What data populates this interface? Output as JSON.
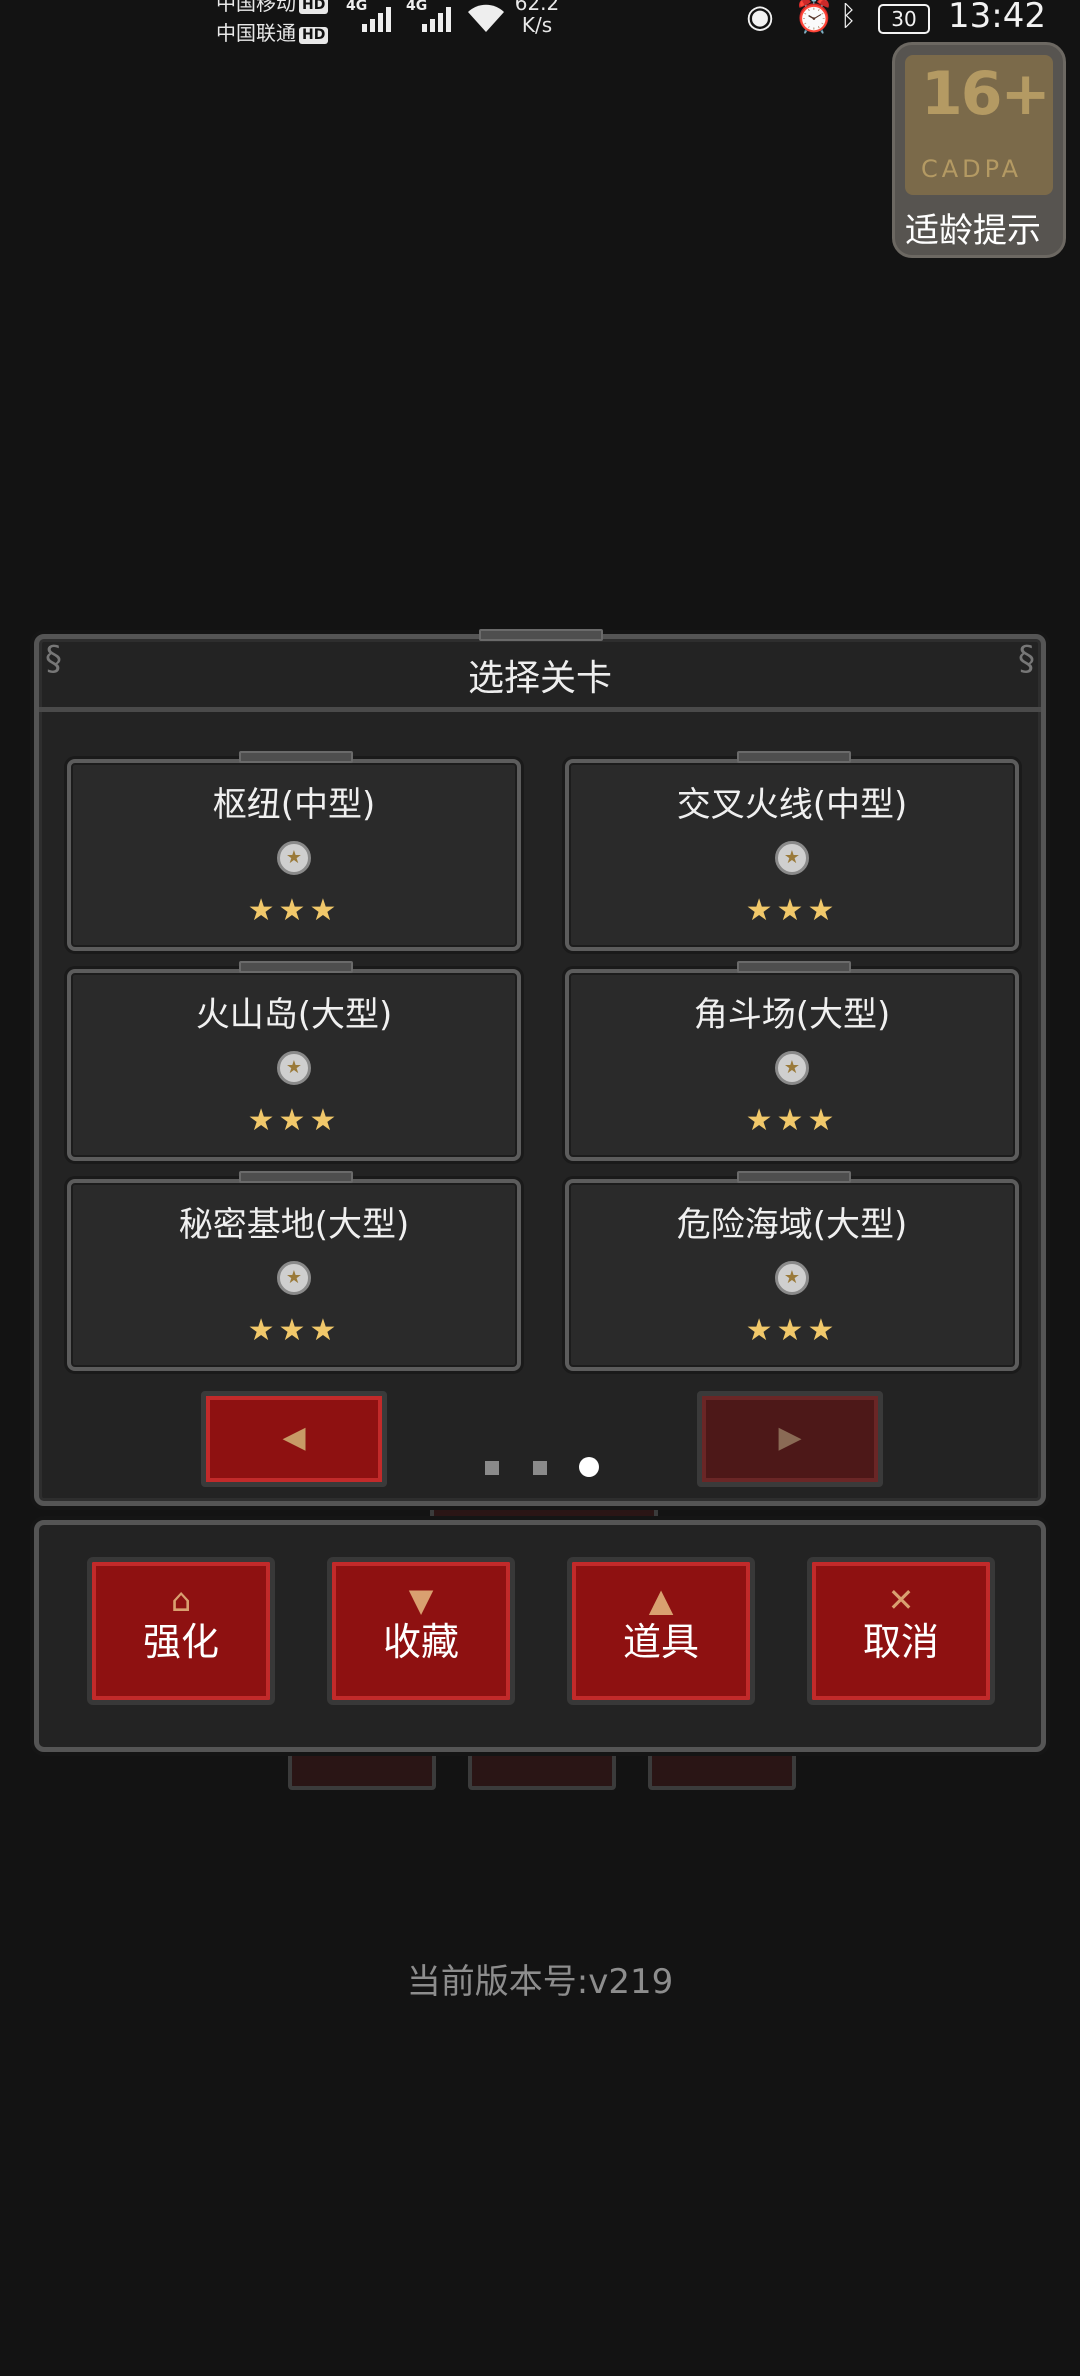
{
  "status_bar": {
    "carrier1": "中国移动",
    "carrier2": "中国联通",
    "hd_badge": "HD",
    "network_type": "4G",
    "net_speed_value": "62.2",
    "net_speed_unit": "K/s",
    "battery_level": "30",
    "time": "13:42"
  },
  "age_rating": {
    "age": "16+",
    "org": "CADPA",
    "label": "适龄提示"
  },
  "dialog": {
    "title": "选择关卡",
    "levels": [
      {
        "name": "枢纽(中型)",
        "stars": "★★★"
      },
      {
        "name": "交叉火线(中型)",
        "stars": "★★★"
      },
      {
        "name": "火山岛(大型)",
        "stars": "★★★"
      },
      {
        "name": "角斗场(大型)",
        "stars": "★★★"
      },
      {
        "name": "秘密基地(大型)",
        "stars": "★★★"
      },
      {
        "name": "危险海域(大型)",
        "stars": "★★★"
      }
    ],
    "prev_arrow": "◀",
    "next_arrow": "▶",
    "page": {
      "current": 3,
      "total": 3
    }
  },
  "actions": {
    "upgrade": {
      "label": "强化",
      "icon": "⌂"
    },
    "collection": {
      "label": "收藏",
      "icon": "▼"
    },
    "items": {
      "label": "道具",
      "icon": "▲"
    },
    "cancel": {
      "label": "取消",
      "icon": "✕"
    }
  },
  "version_text": "当前版本号:v219",
  "colors": {
    "button_red": "#8e1111",
    "star_gold": "#f1c86a",
    "panel_bg": "#232323"
  }
}
